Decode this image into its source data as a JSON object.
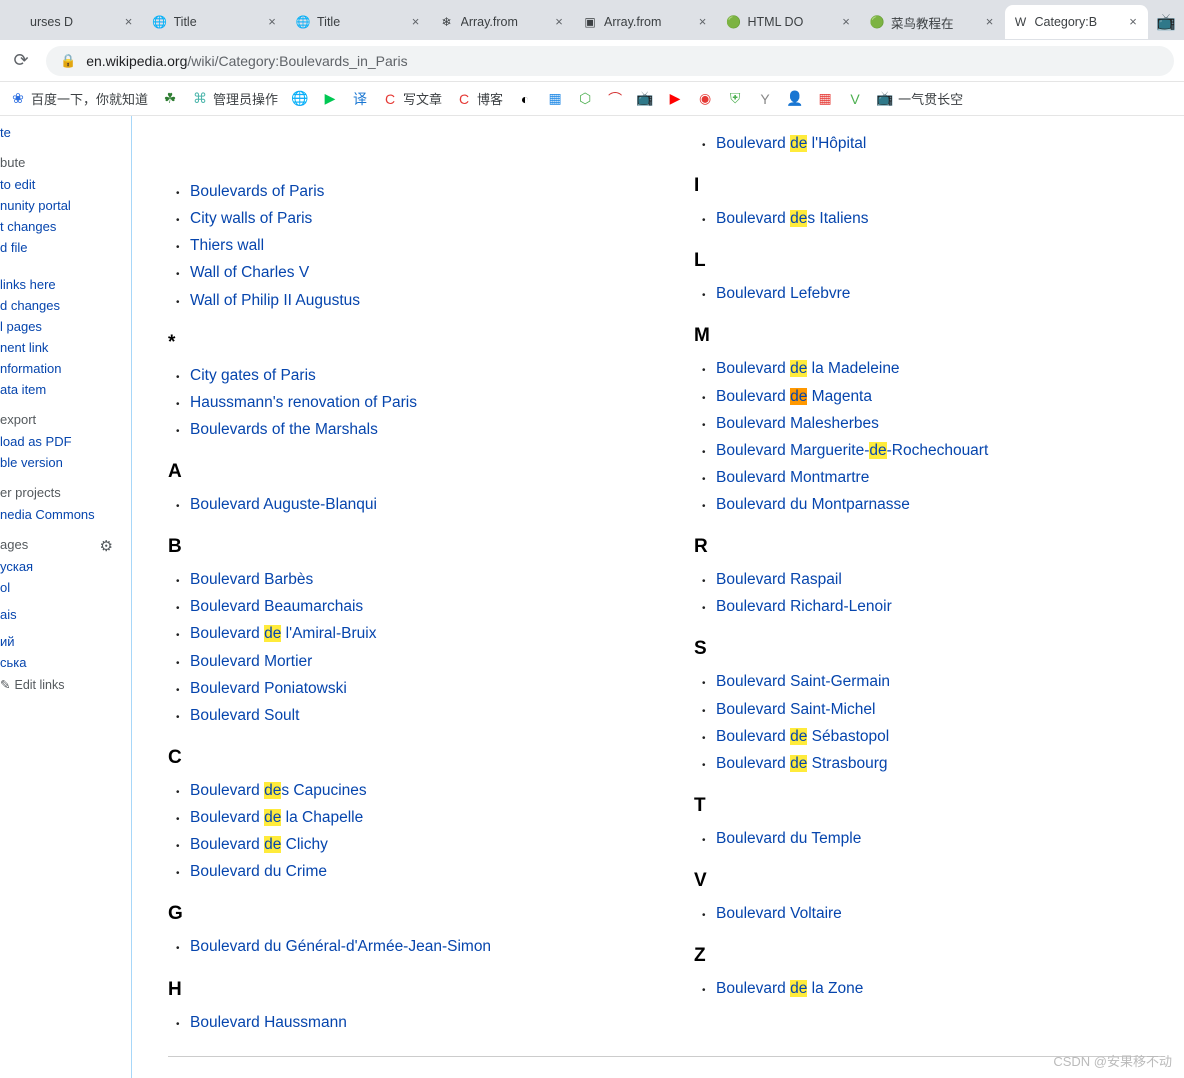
{
  "browser": {
    "tabs": [
      {
        "label": "urses D",
        "favicon": "",
        "active": false
      },
      {
        "label": "Title",
        "favicon": "🌐",
        "active": false
      },
      {
        "label": "Title",
        "favicon": "🌐",
        "active": false
      },
      {
        "label": "Array.from",
        "favicon": "❄",
        "active": false
      },
      {
        "label": "Array.from",
        "favicon": "▣",
        "active": false
      },
      {
        "label": "HTML DO",
        "favicon": "🟢",
        "active": false
      },
      {
        "label": "菜鸟教程在",
        "favicon": "🟢",
        "active": false
      },
      {
        "label": "Category:B",
        "favicon": "W",
        "active": true
      }
    ],
    "overflow_icon": "📺",
    "url_host": "en.wikipedia.org",
    "url_path": "/wiki/Category:Boulevards_in_Paris"
  },
  "bookmarks": [
    {
      "icon": "❀",
      "label": "百度一下，你就知道",
      "color": "#2a6de1"
    },
    {
      "icon": "☘",
      "label": "",
      "color": "#2e7d32"
    },
    {
      "icon": "⌘",
      "label": "管理员操作",
      "color": "#4db6ac"
    },
    {
      "icon": "🌐",
      "label": "",
      "color": "#4285f4"
    },
    {
      "icon": "▶",
      "label": "",
      "color": "#00c853"
    },
    {
      "icon": "译",
      "label": "",
      "color": "#1976d2"
    },
    {
      "icon": "C",
      "label": "写文章",
      "color": "#e53935"
    },
    {
      "icon": "C",
      "label": "博客",
      "color": "#e53935"
    },
    {
      "icon": "◐",
      "label": "",
      "color": "#000"
    },
    {
      "icon": "▦",
      "label": "",
      "color": "#1e88e5"
    },
    {
      "icon": "⬡",
      "label": "",
      "color": "#4caf50"
    },
    {
      "icon": "⌒",
      "label": "",
      "color": "#d32f2f"
    },
    {
      "icon": "📺",
      "label": "",
      "color": "#1e88e5"
    },
    {
      "icon": "▶",
      "label": "",
      "color": "#ff0000"
    },
    {
      "icon": "◉",
      "label": "",
      "color": "#e53935"
    },
    {
      "icon": "⛨",
      "label": "",
      "color": "#4caf50"
    },
    {
      "icon": "Y",
      "label": "",
      "color": "#888"
    },
    {
      "icon": "👤",
      "label": "",
      "color": "#3f51b5"
    },
    {
      "icon": "▦",
      "label": "",
      "color": "#e53935"
    },
    {
      "icon": "V",
      "label": "",
      "color": "#4caf50"
    },
    {
      "icon": "📺",
      "label": "一气贯长空",
      "color": "#1e88e5"
    }
  ],
  "sidebar": {
    "top_stub": "te",
    "sections": [
      {
        "heading": "bute",
        "links": [
          "to edit",
          "nunity portal",
          "t changes",
          "d file"
        ]
      },
      {
        "heading": "",
        "links": [
          "links here",
          "d changes",
          "l pages",
          "nent link",
          "nformation",
          "ata item"
        ]
      },
      {
        "heading": "export",
        "links": [
          "load as PDF",
          "ble version"
        ]
      },
      {
        "heading": "er projects",
        "links": [
          "nedia Commons"
        ]
      },
      {
        "heading": "ages",
        "gear": true,
        "links": [
          "уская",
          "ol",
          "",
          "ais",
          "",
          "ий",
          "ська"
        ]
      }
    ],
    "edit_links_label": "Edit links"
  },
  "highlight": {
    "term": "de",
    "active_index": 8
  },
  "category": {
    "left": [
      {
        "letter": "",
        "items": [
          "Boulevards of Paris",
          "City walls of Paris",
          "Thiers wall",
          "Wall of Charles V",
          "Wall of Philip II Augustus"
        ]
      },
      {
        "letter": "*",
        "items": [
          "City gates of Paris",
          "Haussmann's renovation of Paris",
          "Boulevards of the Marshals"
        ]
      },
      {
        "letter": "A",
        "items": [
          "Boulevard Auguste-Blanqui"
        ]
      },
      {
        "letter": "B",
        "items": [
          "Boulevard Barbès",
          "Boulevard Beaumarchais",
          "Boulevard de l'Amiral-Bruix",
          "Boulevard Mortier",
          "Boulevard Poniatowski",
          "Boulevard Soult"
        ]
      },
      {
        "letter": "C",
        "items": [
          "Boulevard des Capucines",
          "Boulevard de la Chapelle",
          "Boulevard de Clichy",
          "Boulevard du Crime"
        ]
      },
      {
        "letter": "G",
        "items": [
          "Boulevard du Général-d'Armée-Jean-Simon"
        ]
      },
      {
        "letter": "H",
        "items": [
          "Boulevard Haussmann"
        ]
      }
    ],
    "right": [
      {
        "letter": "",
        "items": [
          "Boulevard de l'Hôpital"
        ]
      },
      {
        "letter": "I",
        "items": [
          "Boulevard des Italiens"
        ]
      },
      {
        "letter": "L",
        "items": [
          "Boulevard Lefebvre"
        ]
      },
      {
        "letter": "M",
        "items": [
          "Boulevard de la Madeleine",
          "Boulevard de Magenta",
          "Boulevard Malesherbes",
          "Boulevard Marguerite-de-Rochechouart",
          "Boulevard Montmartre",
          "Boulevard du Montparnasse"
        ]
      },
      {
        "letter": "R",
        "items": [
          "Boulevard Raspail",
          "Boulevard Richard-Lenoir"
        ]
      },
      {
        "letter": "S",
        "items": [
          "Boulevard Saint-Germain",
          "Boulevard Saint-Michel",
          "Boulevard de Sébastopol",
          "Boulevard de Strasbourg"
        ]
      },
      {
        "letter": "T",
        "items": [
          "Boulevard du Temple"
        ]
      },
      {
        "letter": "V",
        "items": [
          "Boulevard Voltaire"
        ]
      },
      {
        "letter": "Z",
        "items": [
          "Boulevard de la Zone"
        ]
      }
    ]
  },
  "watermark": "CSDN @安果移不动"
}
